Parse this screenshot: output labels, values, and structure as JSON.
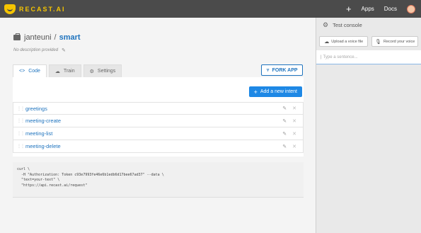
{
  "topbar": {
    "logo_text": "RECAST.AI",
    "add_label": "+",
    "apps_label": "Apps",
    "docs_label": "Docs"
  },
  "repo": {
    "owner": "janteuni",
    "separator": "/",
    "name": "smart",
    "description": "No description provided"
  },
  "tabs": [
    {
      "label": "Code",
      "icon": "code-icon"
    },
    {
      "label": "Train",
      "icon": "train-icon"
    },
    {
      "label": "Settings",
      "icon": "gear-icon"
    }
  ],
  "fork_button": "FORK APP",
  "add_intent_button": "Add a new intent",
  "intents": [
    {
      "name": "greetings"
    },
    {
      "name": "meeting-create"
    },
    {
      "name": "meeting-list"
    },
    {
      "name": "meeting-delete"
    }
  ],
  "code_sample": [
    "curl \\",
    "  -H \"Authorization: Token c93e7993fe46e6b1edb6d17bee67ad37\" --data \\",
    "  \"text=your-text\" \\",
    "  \"https://api.recast.ai/request\""
  ],
  "console": {
    "title": "Test console",
    "upload_label": "Upload a voice file",
    "record_label": "Record your voice",
    "input_placeholder": "Type a sentence..."
  },
  "colors": {
    "accent": "#1e73be",
    "button_blue": "#1e88e5",
    "topbar": "#4b4b4b",
    "logo": "#f5c400"
  }
}
